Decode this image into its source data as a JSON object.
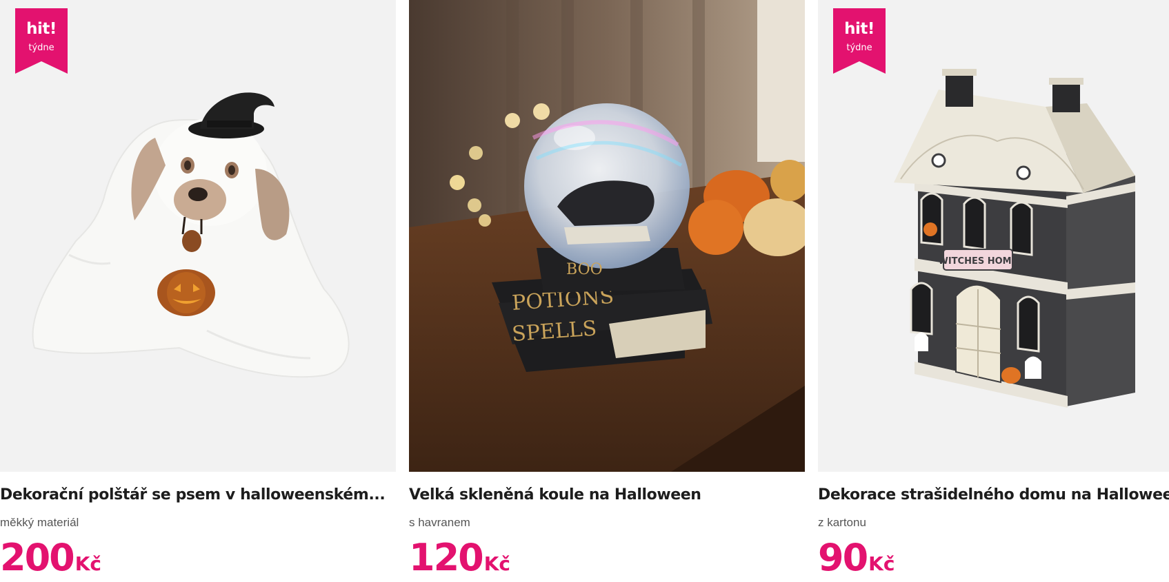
{
  "products": [
    {
      "title": "Dekorační polštář se psem v halloweenském...",
      "subtitle": "měkký materiál",
      "price": "200",
      "currency": "Kč",
      "badge": {
        "line1": "hit!",
        "line2": "týdne"
      },
      "image": "ghost-dog-pillow-image"
    },
    {
      "title": "Velká skleněná koule na Halloween",
      "subtitle": "s havranem",
      "price": "120",
      "currency": "Kč",
      "image": "halloween-snow-globe-image"
    },
    {
      "title": "Dekorace strašidelného domu na Halloween",
      "subtitle": "z kartonu",
      "price": "90",
      "currency": "Kč",
      "badge": {
        "line1": "hit!",
        "line2": "týdne"
      },
      "image": "haunted-house-decoration-image",
      "image_text": "WITCHES HOME"
    }
  ],
  "colors": {
    "accent": "#e3126f",
    "image_bg": "#f2f2f2"
  }
}
